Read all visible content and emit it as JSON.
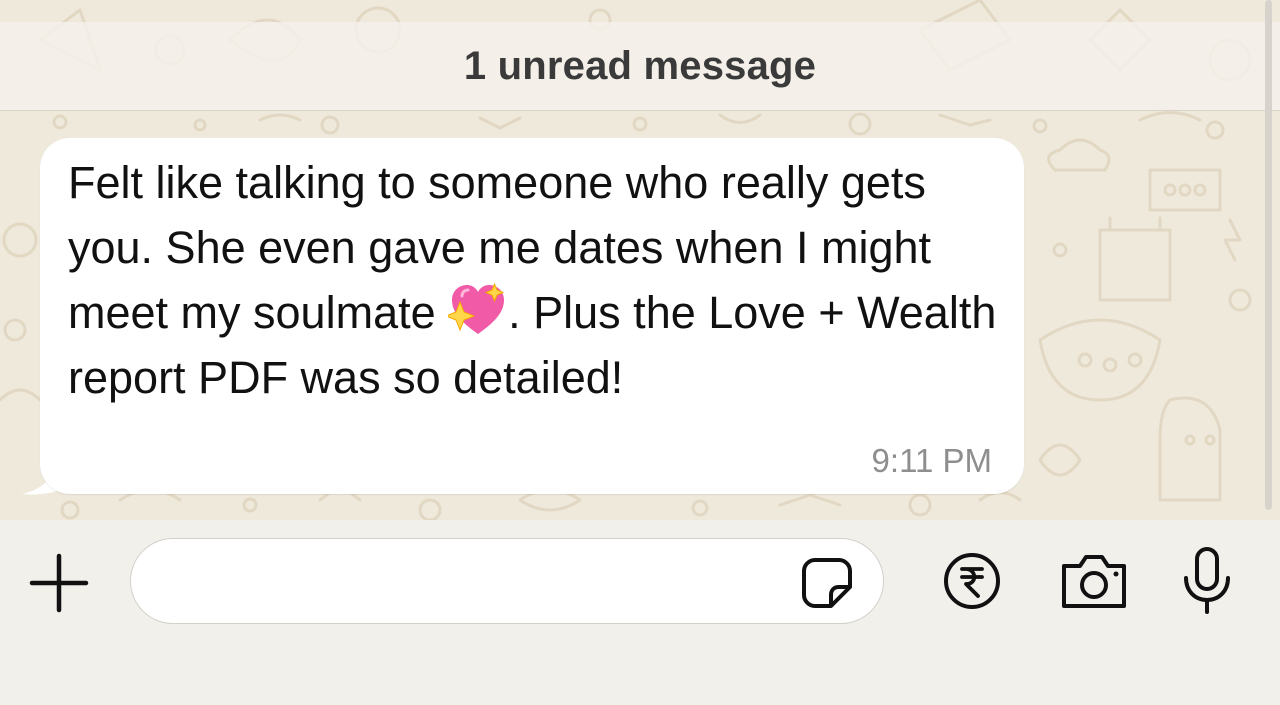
{
  "chat": {
    "unread_banner": "1 unread message",
    "messages": [
      {
        "direction": "incoming",
        "text_part1": "Felt like talking to someone who really gets you. She even gave me dates when I might meet my soulmate ",
        "emoji": "sparkling-heart",
        "text_part2": ". Plus the Love + Wealth report PDF was so detailed!",
        "time": "9:11 PM"
      }
    ]
  },
  "composer": {
    "input_value": "",
    "input_placeholder": "",
    "buttons": [
      "plus-icon",
      "sticker-icon",
      "rupee-payment-icon",
      "camera-icon",
      "microphone-icon"
    ]
  },
  "colors": {
    "wallpaper": "#efe9dc",
    "doodle": "#e3d9c6",
    "bubble": "#ffffff",
    "timestamp": "#8e8e8e",
    "heart_pink": "#f05aa6"
  }
}
